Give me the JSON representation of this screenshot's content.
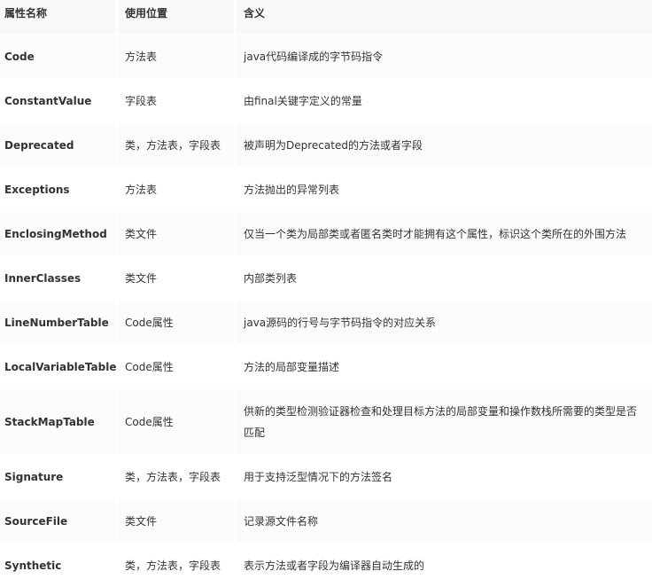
{
  "headers": [
    "属性名称",
    "使用位置",
    "含义"
  ],
  "rows": [
    {
      "name": "Code",
      "location": "方法表",
      "meaning": "java代码编译成的字节码指令"
    },
    {
      "name": "ConstantValue",
      "location": "字段表",
      "meaning": "由final关键字定义的常量"
    },
    {
      "name": "Deprecated",
      "location": "类，方法表，字段表",
      "meaning": "被声明为Deprecated的方法或者字段"
    },
    {
      "name": "Exceptions",
      "location": "方法表",
      "meaning": "方法抛出的异常列表"
    },
    {
      "name": "EnclosingMethod",
      "location": "类文件",
      "meaning": "仅当一个类为局部类或者匿名类时才能拥有这个属性，标识这个类所在的外围方法"
    },
    {
      "name": "InnerClasses",
      "location": "类文件",
      "meaning": "内部类列表"
    },
    {
      "name": "LineNumberTable",
      "location": "Code属性",
      "meaning": "java源码的行号与字节码指令的对应关系"
    },
    {
      "name": "LocalVariableTable",
      "location": "Code属性",
      "meaning": "方法的局部变量描述"
    },
    {
      "name": "StackMapTable",
      "location": "Code属性",
      "meaning": "供新的类型检测验证器检查和处理目标方法的局部变量和操作数栈所需要的类型是否匹配"
    },
    {
      "name": "Signature",
      "location": "类，方法表，字段表",
      "meaning": "用于支持泛型情况下的方法签名"
    },
    {
      "name": "SourceFile",
      "location": "类文件",
      "meaning": "记录源文件名称"
    },
    {
      "name": "Synthetic",
      "location": "类，方法表，字段表",
      "meaning": "表示方法或者字段为编译器自动生成的"
    }
  ]
}
